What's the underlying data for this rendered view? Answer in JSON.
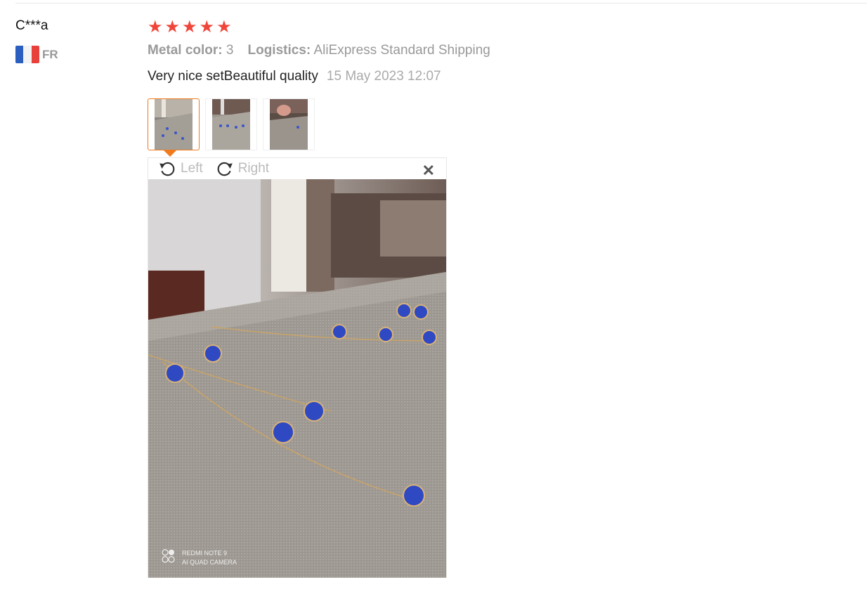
{
  "reviewer": {
    "name": "C***a",
    "country_code": "FR",
    "flag_icon": "france-flag-icon"
  },
  "rating": {
    "stars": 5,
    "star_color": "#f0453a"
  },
  "meta": {
    "metal_color_label": "Metal color:",
    "metal_color_value": "3",
    "logistics_label": "Logistics:",
    "logistics_value": "AliExpress Standard Shipping"
  },
  "review": {
    "text": "Very nice setBeautiful quality",
    "date": "15 May 2023 12:07"
  },
  "thumbnails": {
    "count": 3,
    "active_index": 0,
    "accent": "#f17a1c"
  },
  "viewer": {
    "rotate_left_label": "Left",
    "rotate_right_label": "Right",
    "close_icon": "close-icon",
    "watermark_line1": "REDMI NOTE 9",
    "watermark_line2": "AI QUAD CAMERA"
  }
}
